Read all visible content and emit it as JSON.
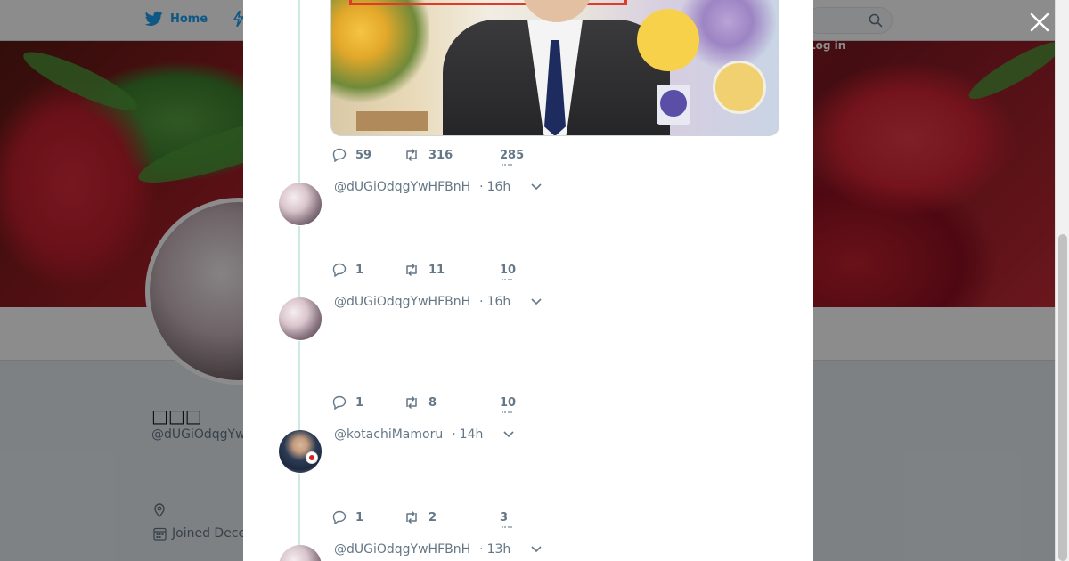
{
  "nav": {
    "home_label": "Home",
    "login_label": "Log in"
  },
  "profile": {
    "name": "□□□",
    "handle": "@dUGiOdqgYw",
    "joined": "Joined Dece"
  },
  "modal": {
    "media_tweet_stats": {
      "replies": "59",
      "retweets": "316",
      "likes": "285"
    },
    "tweets": [
      {
        "handle": "@dUGiOdqgYwHFBnH",
        "time": "16h",
        "replies": "1",
        "retweets": "11",
        "likes": "10"
      },
      {
        "handle": "@dUGiOdqgYwHFBnH",
        "time": "16h",
        "replies": "1",
        "retweets": "8",
        "likes": "10"
      },
      {
        "handle": "@kotachiMamoru",
        "time": "14h",
        "replies": "1",
        "retweets": "2",
        "likes": "3"
      },
      {
        "handle": "@dUGiOdqgYwHFBnH",
        "time": "13h"
      }
    ]
  },
  "icons": {
    "close": "close-icon",
    "reply": "reply-icon",
    "retweet": "retweet-icon",
    "chevron": "chevron-down-icon",
    "search": "search-icon",
    "location": "location-icon",
    "calendar": "calendar-icon"
  },
  "colors": {
    "brand": "#1da1f2",
    "text_secondary": "#657786",
    "thread_line": "#cde9e4"
  }
}
